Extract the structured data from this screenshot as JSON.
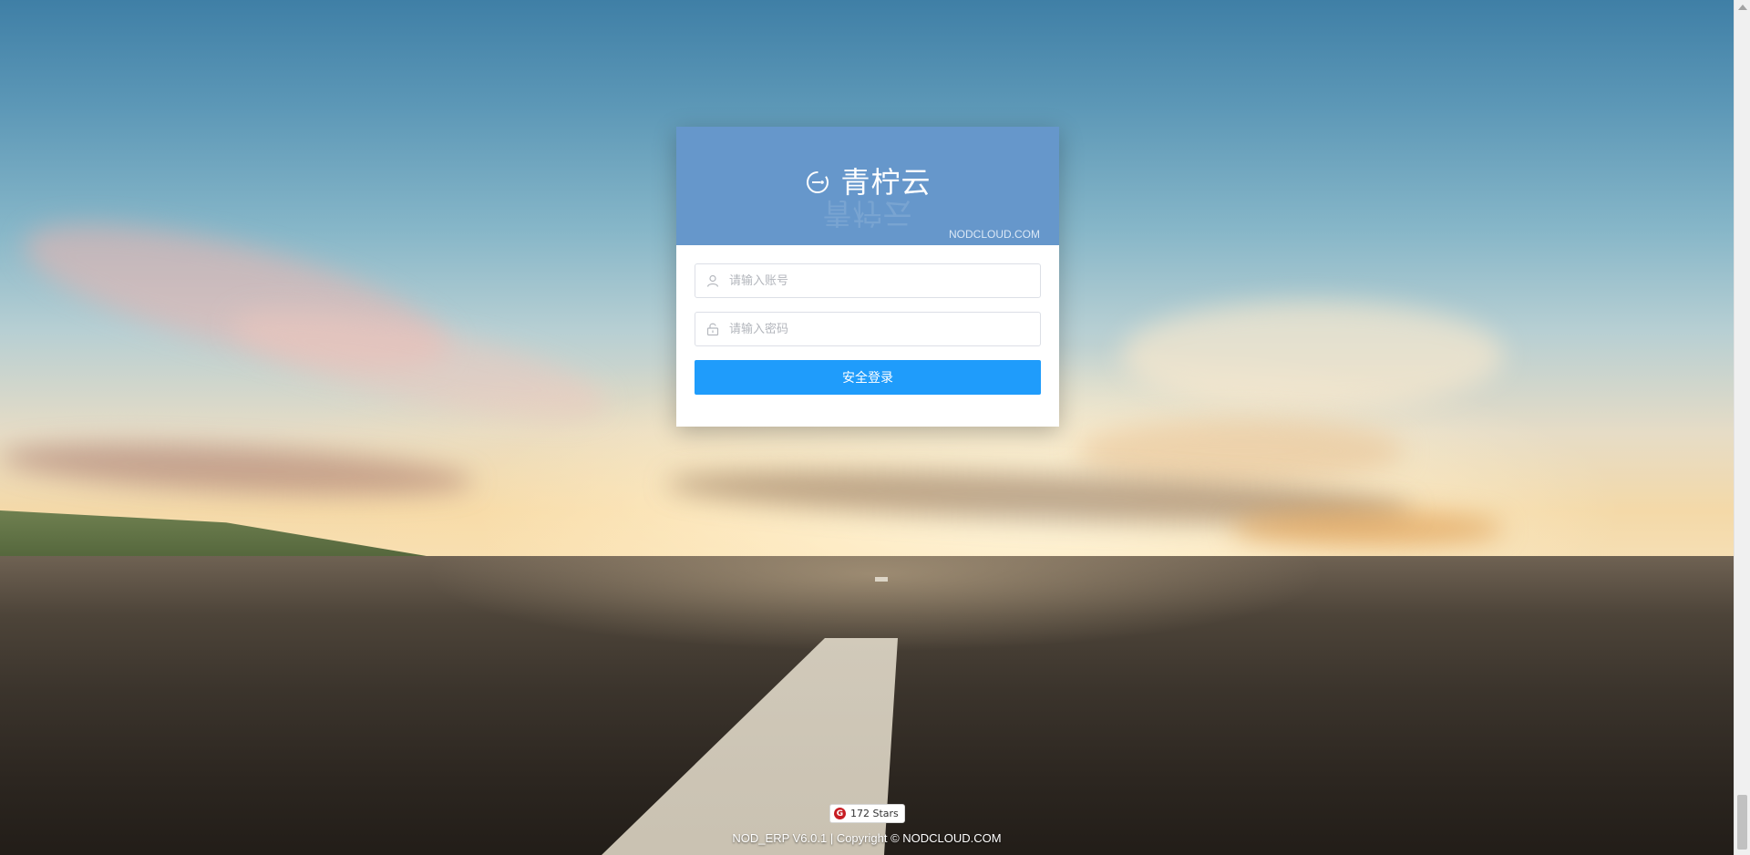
{
  "brand": {
    "name": "青柠云",
    "site": "NODCLOUD.COM",
    "header_color": "#6697cb"
  },
  "login": {
    "account_placeholder": "请输入账号",
    "password_placeholder": "请输入密码",
    "submit_label": "安全登录",
    "button_color": "#1f9cfb"
  },
  "footer": {
    "stars_label": "172 Stars",
    "copyright": "NOD_ERP V6.0.1 | Copyright © NODCLOUD.COM"
  },
  "icons": {
    "logo": "lemon-logo-icon",
    "account": "user-icon",
    "password": "lock-icon",
    "gitee": "gitee-icon"
  }
}
